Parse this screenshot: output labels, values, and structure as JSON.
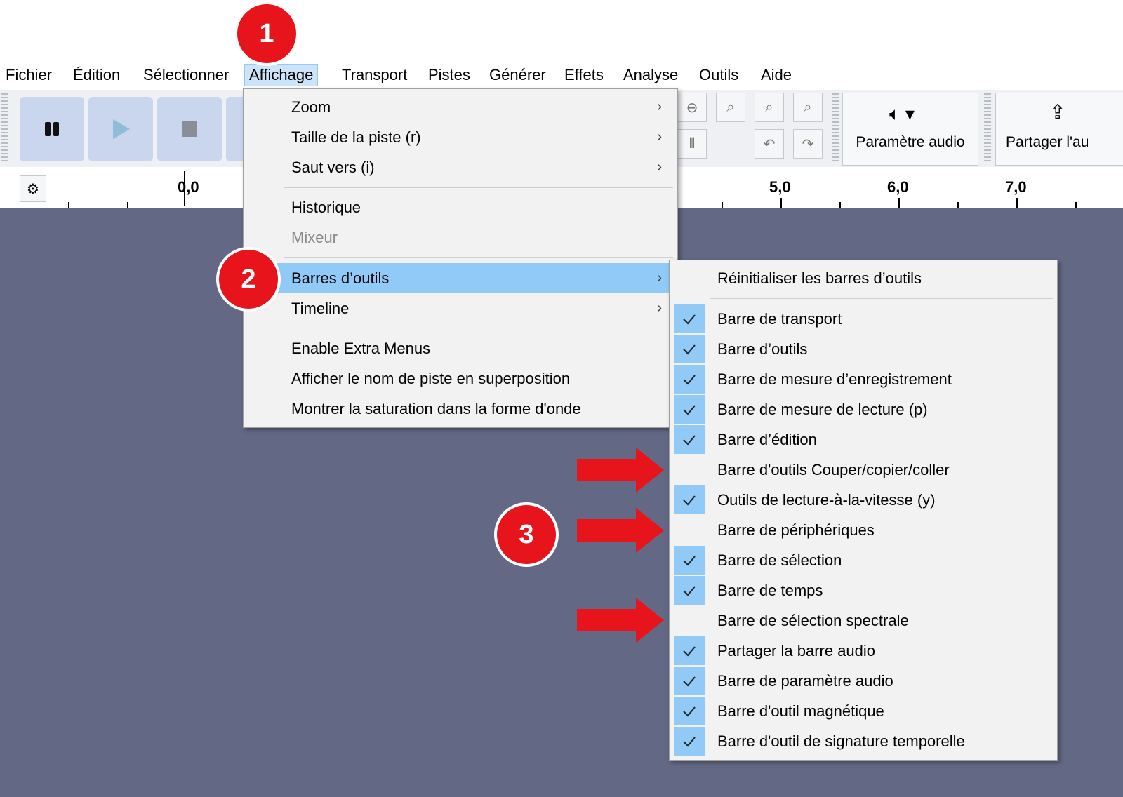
{
  "menubar": {
    "items": [
      "Fichier",
      "Édition",
      "Sélectionner",
      "Affichage",
      "Transport",
      "Pistes",
      "Générer",
      "Effets",
      "Analyse",
      "Outils",
      "Aide"
    ],
    "active": "Affichage"
  },
  "toolbar": {
    "audio_setup_label": "Paramètre audio",
    "share_label": "Partager l'au"
  },
  "ruler": {
    "labels": [
      "0,0",
      "5,0",
      "6,0",
      "7,0"
    ]
  },
  "view_menu": {
    "items": [
      {
        "label": "Zoom",
        "submenu": true
      },
      {
        "label": "Taille de la piste (r)",
        "submenu": true
      },
      {
        "label": "Saut vers (i)",
        "submenu": true
      },
      {
        "label": "Historique",
        "submenu": false
      },
      {
        "label": "Mixeur",
        "submenu": false,
        "disabled": true
      },
      {
        "label": "Barres d’outils",
        "submenu": true,
        "highlighted": true
      },
      {
        "label": "Timeline",
        "submenu": true
      },
      {
        "label": "Enable Extra Menus",
        "submenu": false
      },
      {
        "label": "Afficher le nom de piste en superposition",
        "submenu": false
      },
      {
        "label": "Montrer la saturation dans la forme d'onde",
        "submenu": false
      }
    ]
  },
  "toolbars_submenu": {
    "reset_label": "Réinitialiser les barres d’outils",
    "items": [
      {
        "label": "Barre de transport",
        "checked": true
      },
      {
        "label": "Barre d’outils",
        "checked": true
      },
      {
        "label": "Barre de mesure d’enregistrement",
        "checked": true
      },
      {
        "label": "Barre de mesure de lecture (p)",
        "checked": true
      },
      {
        "label": "Barre d’édition",
        "checked": true
      },
      {
        "label": "Barre d'outils Couper/copier/coller",
        "checked": false
      },
      {
        "label": "Outils de lecture-à-la-vitesse (y)",
        "checked": true
      },
      {
        "label": "Barre de périphériques",
        "checked": false
      },
      {
        "label": "Barre de sélection",
        "checked": true
      },
      {
        "label": "Barre de temps",
        "checked": true
      },
      {
        "label": "Barre de sélection spectrale",
        "checked": false
      },
      {
        "label": "Partager la barre audio",
        "checked": true
      },
      {
        "label": "Barre de paramètre audio",
        "checked": true
      },
      {
        "label": "Barre d'outil magnétique",
        "checked": true
      },
      {
        "label": "Barre d'outil de signature temporelle",
        "checked": true
      }
    ]
  },
  "annotations": {
    "badges": [
      "1",
      "2",
      "3"
    ],
    "badge_color": "#e8141b",
    "arrow_color": "#e8141b"
  },
  "colors": {
    "track_background": "#636985",
    "menu_highlight": "#91c9f7",
    "transport_button": "#c9d6ee"
  }
}
